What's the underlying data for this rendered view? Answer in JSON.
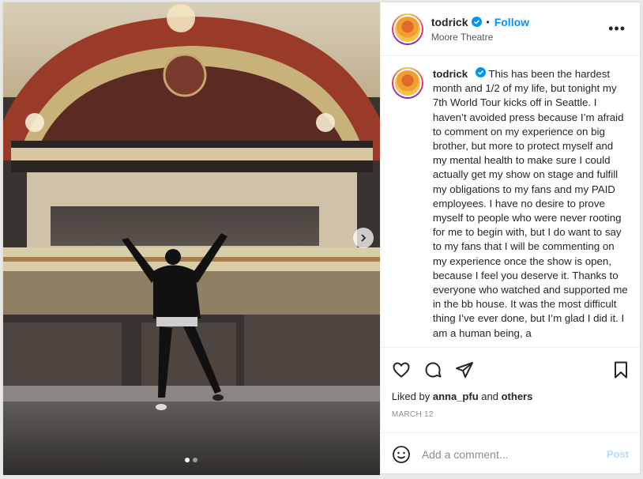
{
  "post": {
    "author": "todrick",
    "follow_label": "Follow",
    "separator": "•",
    "location": "Moore Theatre",
    "more_label": "•••",
    "caption": "This has been the hardest month and 1/2 of my life, but tonight my 7th World Tour kicks off in Seattle. I haven’t avoided press because I’m afraid to comment on my experience on big brother, but more to protect myself and my mental health to make sure I could actually get my show on stage and fulfill my obligations to my fans and my PAID employees. I have no desire to prove myself to people who were never rooting for me to begin with, but I do want to say to my fans that I will be commenting on my experience once the show is open, because I feel you deserve it. Thanks to everyone who watched and supported me in the bb house. It was the most difficult thing I’ve ever done, but I’m glad I did it. I am a human being, a",
    "liked_prefix": "Liked by",
    "liked_user": "anna_pfu",
    "liked_and": "and",
    "liked_others": "others",
    "date": "MARCH 12"
  },
  "carousel": {
    "total": 2,
    "active_index": 0
  },
  "comment": {
    "placeholder": "Add a comment...",
    "post_label": "Post"
  },
  "icons": {
    "verified": "verified-badge-icon",
    "like": "heart-icon",
    "comment": "comment-icon",
    "share": "send-icon",
    "save": "bookmark-icon",
    "emoji": "emoji-icon",
    "next": "chevron-right-icon"
  },
  "colors": {
    "accent": "#0095f6",
    "post_disabled": "#b3dbff",
    "muted": "#8e8e8e"
  }
}
